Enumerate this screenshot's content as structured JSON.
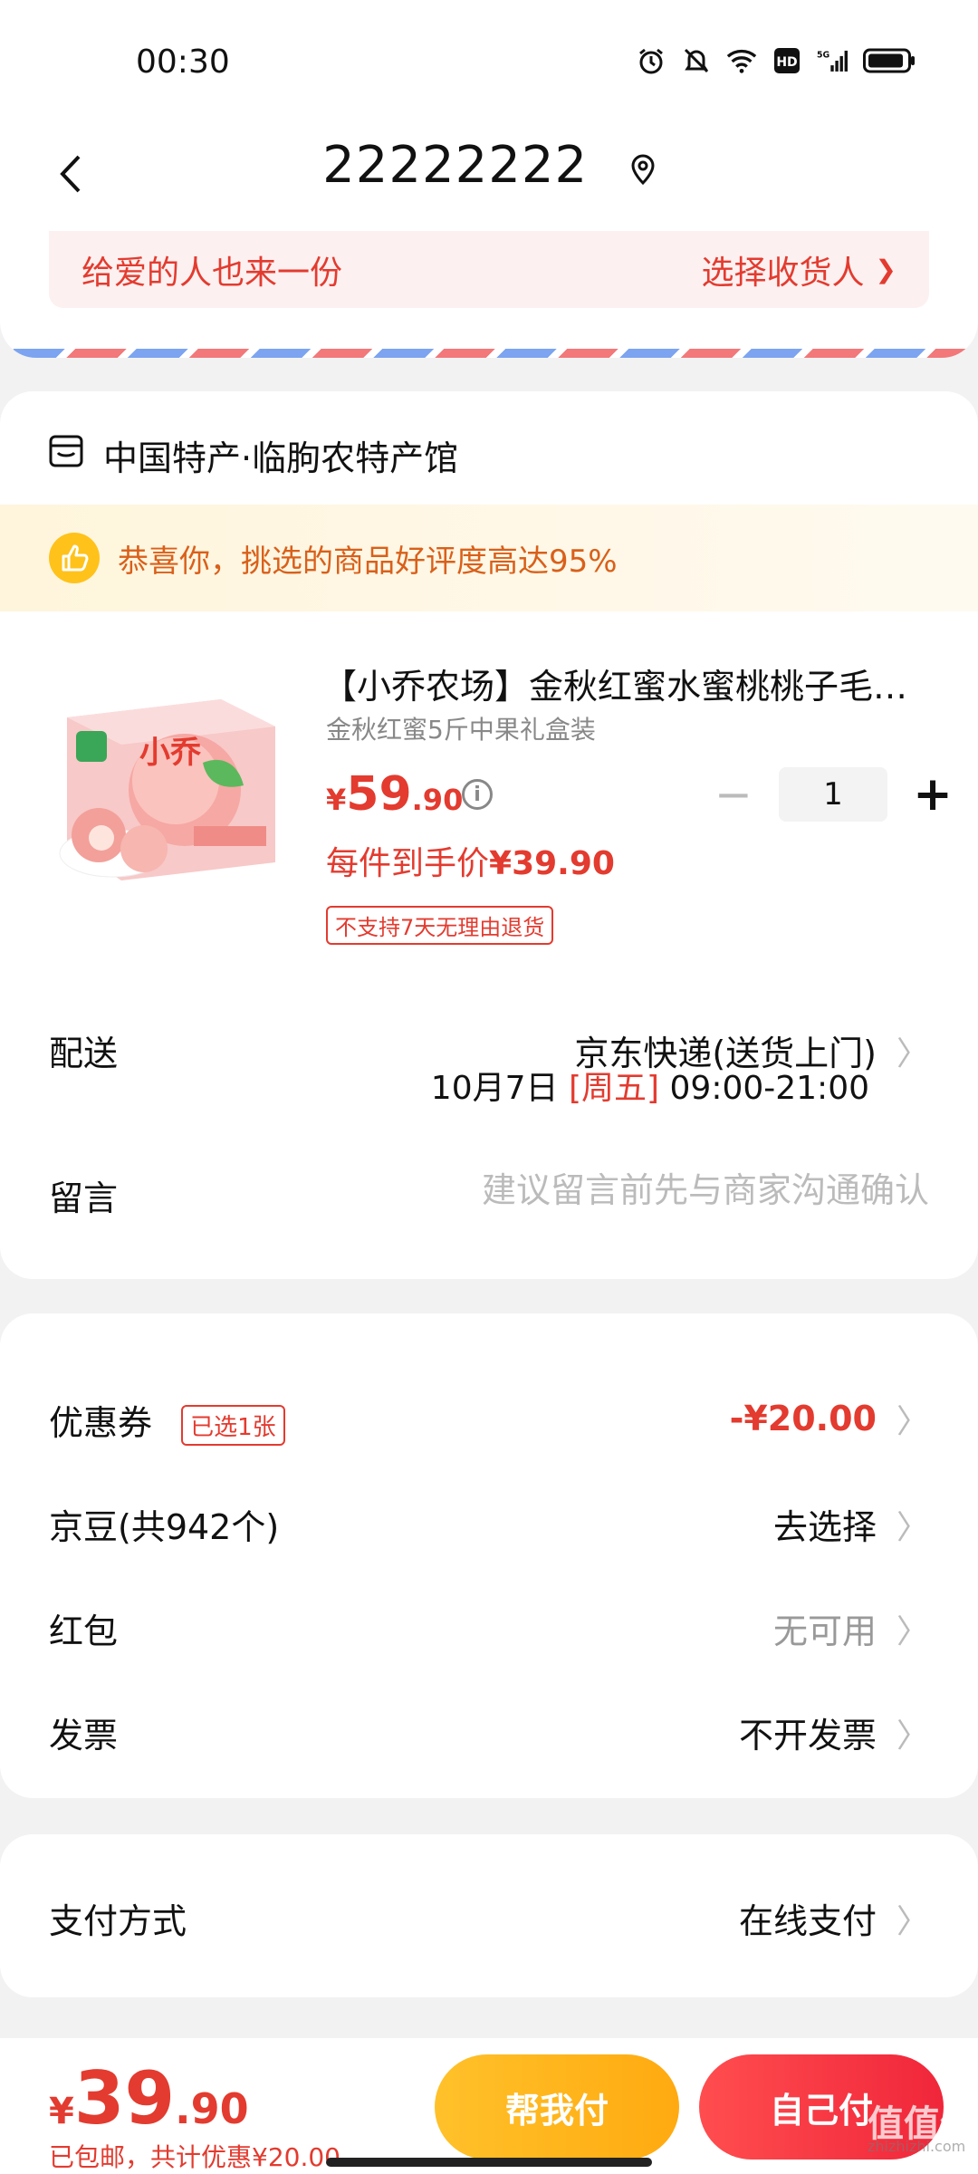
{
  "status_bar": {
    "time": "00:30",
    "icons": [
      "alarm-icon",
      "mute-bell-icon",
      "wifi-icon",
      "hd-icon",
      "5g-signal-icon",
      "battery-icon"
    ]
  },
  "nav": {
    "title": "22222222"
  },
  "gift_bar": {
    "left_text": "给爱的人也来一份",
    "right_text": "选择收货人",
    "chevron": "❯"
  },
  "shop": {
    "name": "中国特产·临朐农特产馆",
    "praise_text": "恭喜你，挑选的商品好评度高达95%"
  },
  "product": {
    "title": "【小乔农场】金秋红蜜水蜜桃桃子毛…",
    "spec": "金秋红蜜5斤中果礼盒装",
    "price_currency": "¥",
    "price_int": "59",
    "price_dec": ".90",
    "info_glyph": "i",
    "quantity": "1",
    "minus": "−",
    "plus": "+",
    "final_price_label": "每件到手价",
    "final_price": "¥39.90",
    "return_policy": "不支持7天无理由退货"
  },
  "delivery": {
    "label": "配送",
    "method": "京东快递(送货上门)",
    "date": "10月7日",
    "weekday": "[周五]",
    "time_range": "09:00-21:00",
    "chevron": "〉"
  },
  "message": {
    "label": "留言",
    "placeholder": "建议留言前先与商家沟通确认"
  },
  "discounts": {
    "coupon_label": "优惠券",
    "coupon_tag": "已选1张",
    "coupon_value": "-¥20.00",
    "beans_label": "京豆(共942个)",
    "beans_value": "去选择",
    "redpacket_label": "红包",
    "redpacket_value": "无可用",
    "invoice_label": "发票",
    "invoice_value": "不开发票",
    "chevron": "〉"
  },
  "payment": {
    "label": "支付方式",
    "value": "在线支付",
    "chevron": "〉"
  },
  "checkout": {
    "currency": "¥",
    "total_int": "39",
    "total_dec": ".90",
    "note": "已包邮，共计优惠¥20.00",
    "help_pay_label": "帮我付",
    "self_pay_label": "自己付"
  },
  "watermark": {
    "text": "值值值",
    "sub": "zhizhizhi.com"
  },
  "colors": {
    "accent_red": "#e33b2f",
    "help_button": "#ffb81c",
    "self_button": "#f53a45",
    "praise_bg": "#fff5dc"
  }
}
